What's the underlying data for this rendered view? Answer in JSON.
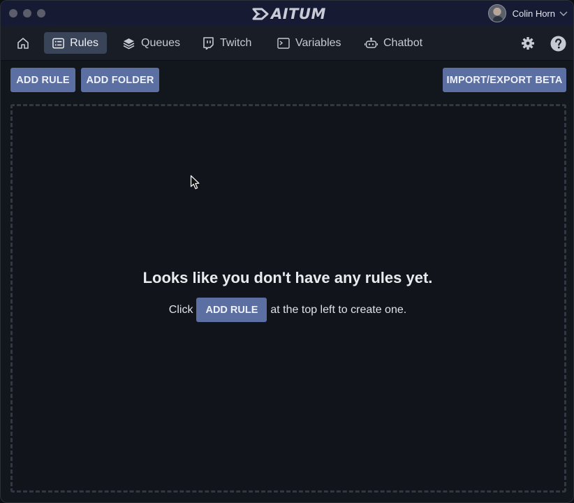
{
  "app": {
    "logo_text": "AITUM",
    "user_name": "Colin Horn"
  },
  "nav": {
    "items": [
      {
        "label": "Rules",
        "icon": "list-icon",
        "active": true
      },
      {
        "label": "Queues",
        "icon": "layers-icon"
      },
      {
        "label": "Twitch",
        "icon": "twitch-icon"
      },
      {
        "label": "Variables",
        "icon": "terminal-icon"
      },
      {
        "label": "Chatbot",
        "icon": "robot-icon"
      }
    ],
    "home_icon": "home-icon",
    "settings_icon": "gear-icon",
    "help_icon": "help-icon"
  },
  "toolbar": {
    "add_rule_label": "ADD RULE",
    "add_folder_label": "ADD FOLDER",
    "import_export_label": "IMPORT/EXPORT BETA"
  },
  "empty_state": {
    "title": "Looks like you don't have any rules yet.",
    "prefix": "Click",
    "button_label": "ADD RULE",
    "suffix": "at the top left to create one."
  },
  "colors": {
    "accent": "#5b6fa3",
    "background": "#12161d",
    "titlebar": "#171a33",
    "nav_active": "#3a4458"
  }
}
